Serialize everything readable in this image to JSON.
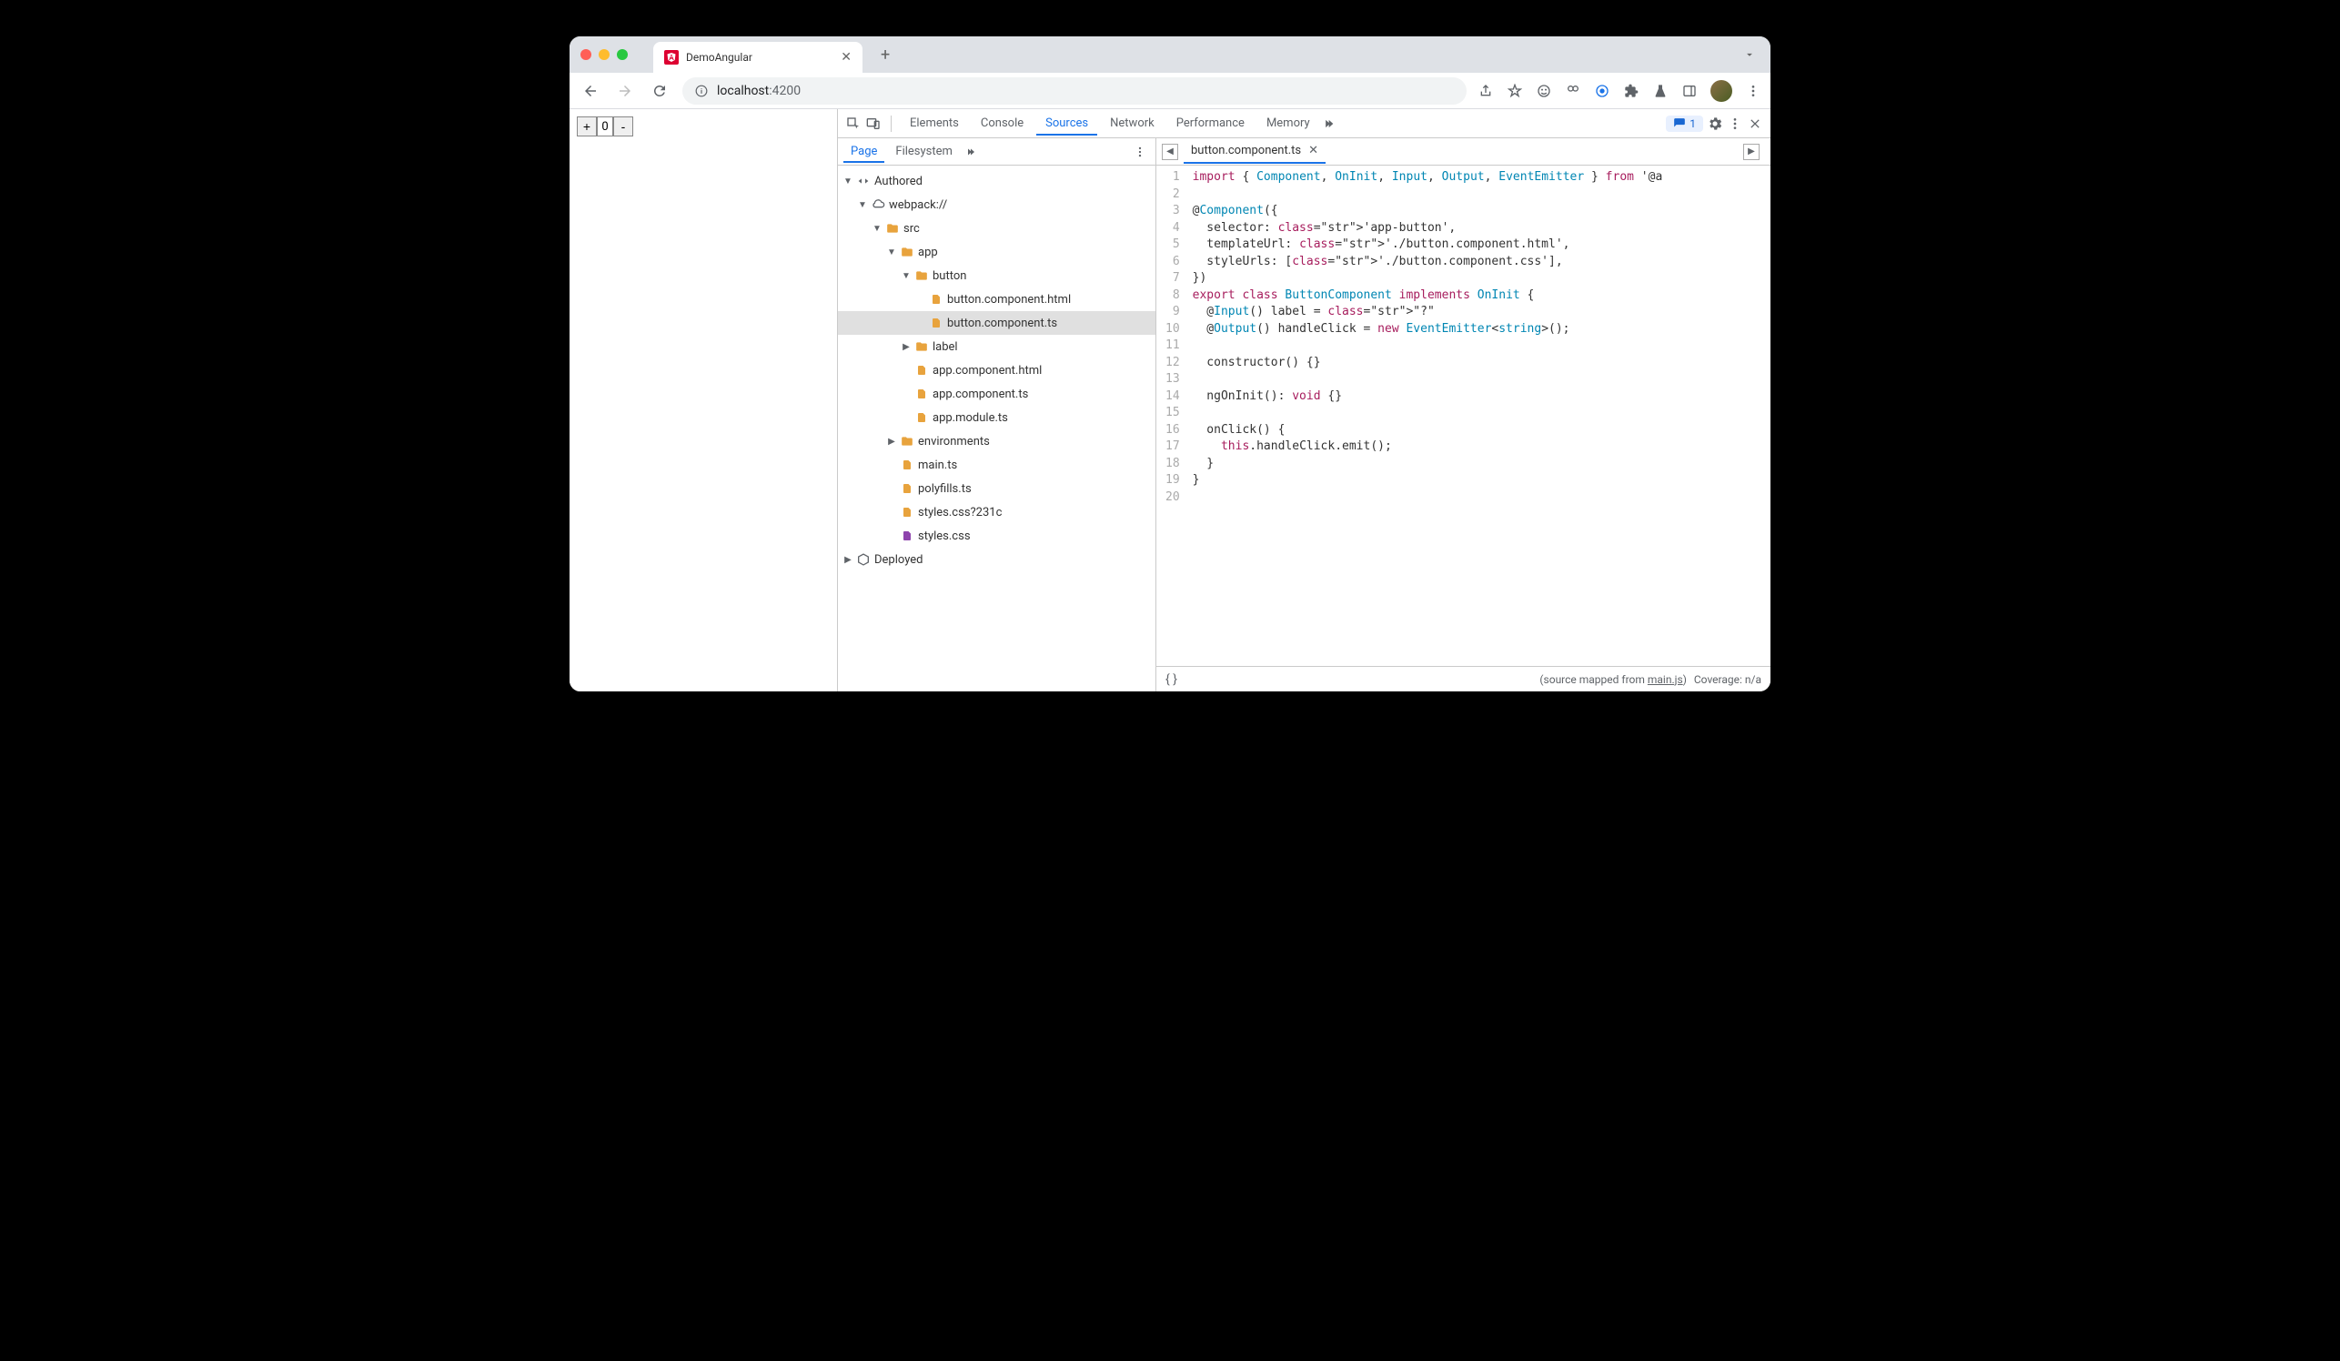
{
  "browser": {
    "tab_title": "DemoAngular",
    "url_host": "localhost",
    "url_port": ":4200"
  },
  "page": {
    "counter_value": "0",
    "plus": "+",
    "minus": "-"
  },
  "devtools": {
    "tabs": [
      "Elements",
      "Console",
      "Sources",
      "Network",
      "Performance",
      "Memory"
    ],
    "active_tab": "Sources",
    "issues_count": "1",
    "sources_tabs": [
      "Page",
      "Filesystem"
    ],
    "active_sources_tab": "Page",
    "editor_tab": "button.component.ts",
    "tree": {
      "authored": "Authored",
      "webpack": "webpack://",
      "src": "src",
      "app": "app",
      "button": "button",
      "button_html": "button.component.html",
      "button_ts": "button.component.ts",
      "label": "label",
      "app_html": "app.component.html",
      "app_ts": "app.component.ts",
      "app_module": "app.module.ts",
      "environments": "environments",
      "main_ts": "main.ts",
      "polyfills": "polyfills.ts",
      "styles_q": "styles.css?231c",
      "styles": "styles.css",
      "deployed": "Deployed"
    },
    "code_lines": [
      "import { Component, OnInit, Input, Output, EventEmitter } from '@a",
      "",
      "@Component({",
      "  selector: 'app-button',",
      "  templateUrl: './button.component.html',",
      "  styleUrls: ['./button.component.css'],",
      "})",
      "export class ButtonComponent implements OnInit {",
      "  @Input() label = \"?\"",
      "  @Output() handleClick = new EventEmitter<string>();",
      "",
      "  constructor() {}",
      "",
      "  ngOnInit(): void {}",
      "",
      "  onClick() {",
      "    this.handleClick.emit();",
      "  }",
      "}",
      ""
    ],
    "status": {
      "source_mapped_prefix": "(source mapped from ",
      "source_mapped_link": "main.js",
      "source_mapped_suffix": ")",
      "coverage": "Coverage: n/a"
    }
  }
}
